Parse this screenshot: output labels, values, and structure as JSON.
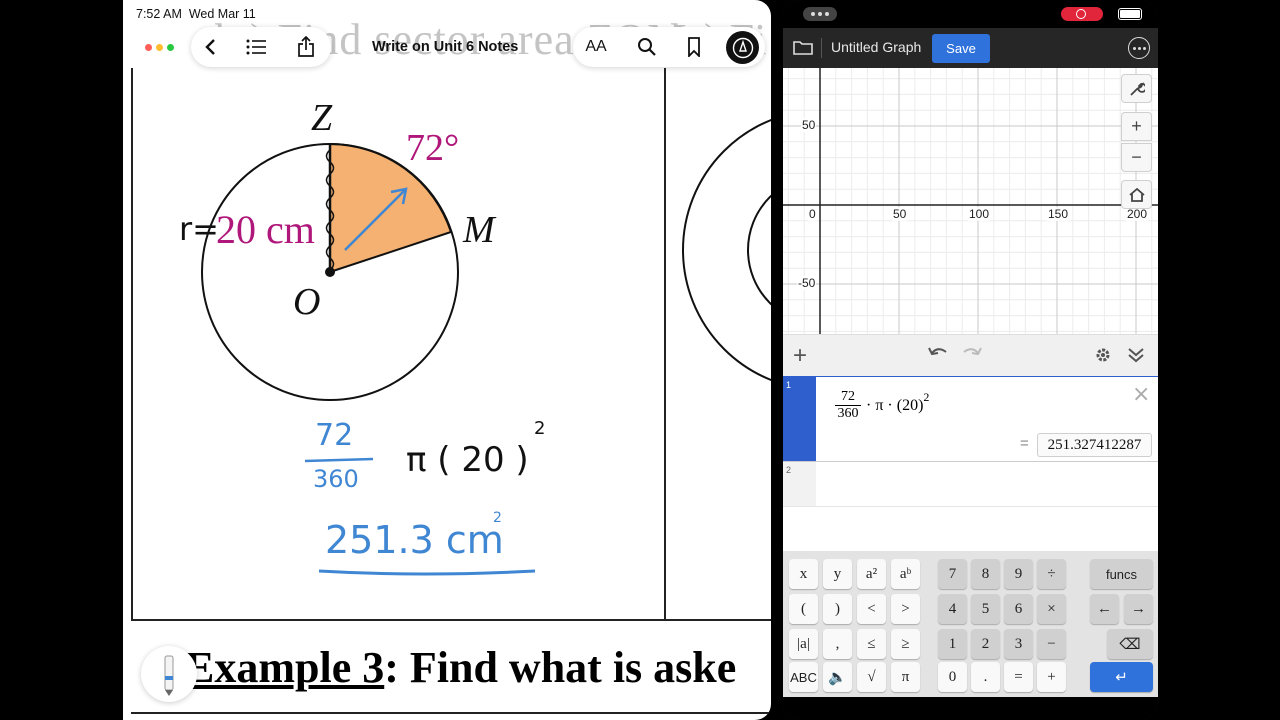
{
  "left": {
    "status_time": "7:52 AM",
    "status_date": "Wed Mar 11",
    "doc_title": "Write on Unit 6 Notes",
    "toolbar": {
      "back_icon": "chevron-left-icon",
      "list_icon": "list-icon",
      "share_icon": "share-icon",
      "text_size_label": "AA",
      "search_icon": "search-icon",
      "bookmark_icon": "bookmark-icon",
      "markup_icon": "pen-markup-icon"
    },
    "faded_heading": "b.) Find sector area ZOM",
    "faded_heading_right": "b.) Fi",
    "diagram": {
      "label_z": "Z",
      "label_m": "M",
      "label_o": "O",
      "angle_label": "72°",
      "radius_label_prefix": "r=",
      "radius_label": "20 cm"
    },
    "work": {
      "numerator": "72",
      "denominator": "360",
      "pi_expr": "π ( 20 )",
      "exponent": "2",
      "answer": "251.3 cm",
      "answer_exp": "2"
    },
    "example_label": "Example 3",
    "example_rest": ":  Find what is aske"
  },
  "right": {
    "graph_title": "Untitled Graph",
    "save_label": "Save",
    "axis": {
      "x_ticks": [
        "0",
        "50",
        "100",
        "150",
        "200"
      ],
      "y_ticks": [
        "50",
        "-50"
      ]
    },
    "expression_1": {
      "index": "1",
      "numerator": "72",
      "denominator": "360",
      "body": "· π · (20)",
      "exponent": "2",
      "equals": "=",
      "result": "251.327412287"
    },
    "expression_2": {
      "index": "2"
    },
    "keypad": {
      "row1": [
        "x",
        "y",
        "a²",
        "aᵇ",
        "7",
        "8",
        "9",
        "÷",
        "funcs"
      ],
      "row2": [
        "(",
        ")",
        "<",
        ">",
        "4",
        "5",
        "6",
        "×",
        "←",
        "→"
      ],
      "row3": [
        "|a|",
        ",",
        "≤",
        "≥",
        "1",
        "2",
        "3",
        "−",
        "⌫"
      ],
      "row4": [
        "ABC",
        "🔈",
        "√",
        "π",
        "0",
        ".",
        "=",
        "+",
        "↵"
      ]
    }
  },
  "colors": {
    "sector_fill": "#f4b171",
    "magenta_text": "#b0177a",
    "handwriting_blue": "#3f86d3",
    "desmos_blue": "#2f72dc"
  }
}
